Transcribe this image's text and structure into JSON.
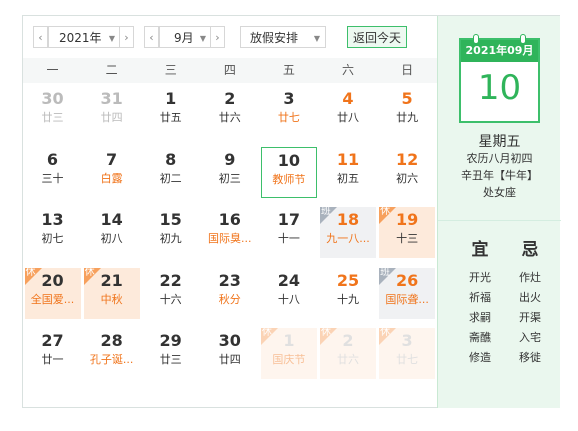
{
  "toolbar": {
    "year": "2021年",
    "month": "9月",
    "holiday_select": "放假安排",
    "today_button": "返回今天"
  },
  "weekdays": [
    "一",
    "二",
    "三",
    "四",
    "五",
    "六",
    "日"
  ],
  "days": [
    {
      "n": "30",
      "s": "廿三",
      "other": true
    },
    {
      "n": "31",
      "s": "廿四",
      "other": true
    },
    {
      "n": "1",
      "s": "廿五"
    },
    {
      "n": "2",
      "s": "廿六"
    },
    {
      "n": "3",
      "s": "廿七",
      "fest": true
    },
    {
      "n": "4",
      "s": "廿八",
      "wk": true
    },
    {
      "n": "5",
      "s": "廿九",
      "wk": true
    },
    {
      "n": "6",
      "s": "三十"
    },
    {
      "n": "7",
      "s": "白露",
      "fest": true
    },
    {
      "n": "8",
      "s": "初二"
    },
    {
      "n": "9",
      "s": "初三"
    },
    {
      "n": "10",
      "s": "教师节",
      "fest": true,
      "today": true
    },
    {
      "n": "11",
      "s": "初五",
      "wk": true
    },
    {
      "n": "12",
      "s": "初六",
      "wk": true
    },
    {
      "n": "13",
      "s": "初七"
    },
    {
      "n": "14",
      "s": "初八"
    },
    {
      "n": "15",
      "s": "初九"
    },
    {
      "n": "16",
      "s": "国际臭...",
      "fest": true
    },
    {
      "n": "17",
      "s": "十一"
    },
    {
      "n": "18",
      "s": "九一八...",
      "fest": true,
      "wk": true,
      "mark": "work",
      "tag": "班"
    },
    {
      "n": "19",
      "s": "十三",
      "wk": true,
      "mark": "rest",
      "tag": "休"
    },
    {
      "n": "20",
      "s": "全国爱...",
      "fest": true,
      "mark": "rest",
      "tag": "休"
    },
    {
      "n": "21",
      "s": "中秋",
      "fest": true,
      "mark": "rest",
      "tag": "休"
    },
    {
      "n": "22",
      "s": "十六"
    },
    {
      "n": "23",
      "s": "秋分",
      "fest": true
    },
    {
      "n": "24",
      "s": "十八"
    },
    {
      "n": "25",
      "s": "十九",
      "wk": true
    },
    {
      "n": "26",
      "s": "国际聋...",
      "fest": true,
      "wk": true,
      "mark": "work",
      "tag": "班"
    },
    {
      "n": "27",
      "s": "廿一"
    },
    {
      "n": "28",
      "s": "孔子诞...",
      "fest": true
    },
    {
      "n": "29",
      "s": "廿三"
    },
    {
      "n": "30",
      "s": "廿四"
    },
    {
      "n": "1",
      "s": "国庆节",
      "fest": true,
      "other": true,
      "mark": "rest",
      "tag": "休",
      "faded": true
    },
    {
      "n": "2",
      "s": "廿六",
      "other": true,
      "mark": "rest",
      "tag": "休",
      "faded": true
    },
    {
      "n": "3",
      "s": "廿七",
      "other": true,
      "mark": "rest",
      "tag": "休",
      "faded": true
    }
  ],
  "side": {
    "header": "2021年09月",
    "day": "10",
    "weekday": "星期五",
    "lunar": "农历八月初四",
    "ganzhi": "辛丑年【牛年】",
    "zodiac": "处女座",
    "yi_label": "宜",
    "ji_label": "忌",
    "yi": [
      "开光",
      "祈福",
      "求嗣",
      "斋醮",
      "修造"
    ],
    "ji": [
      "作灶",
      "出火",
      "开渠",
      "入宅",
      "移徙"
    ]
  },
  "colors": {
    "accent_green": "#2fb45a",
    "holiday_orange": "#f0741b",
    "rest_bg": "#fdeadb",
    "work_bg": "#f0f1f3"
  }
}
